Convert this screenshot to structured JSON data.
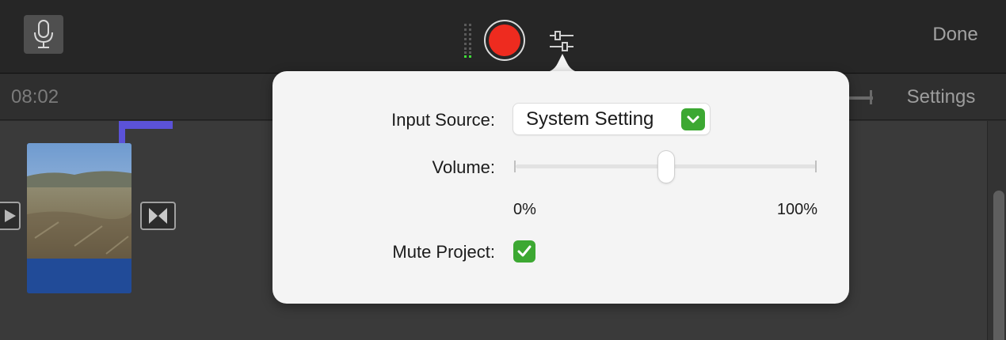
{
  "toolbar": {
    "mic_icon": "microphone-icon",
    "level_meter_icon": "audio-level-meter-icon",
    "record_icon": "record-icon",
    "record_color": "#ee2b1f",
    "settings_icon": "sliders-icon",
    "done_label": "Done"
  },
  "subbar": {
    "timecode": "08:02",
    "settings_label": "Settings"
  },
  "timeline": {
    "playhead_color": "#5b52d8",
    "clip_audio_color": "#214b98",
    "transition_icon": "transition-bowtie-icon"
  },
  "popover": {
    "input_source_label": "Input Source:",
    "input_source_value": "System Setting",
    "volume_label": "Volume:",
    "volume_min_label": "0%",
    "volume_max_label": "100%",
    "volume_level": 0.5,
    "mute_label": "Mute Project:",
    "mute_checked": true,
    "accent_color": "#3ca832"
  }
}
